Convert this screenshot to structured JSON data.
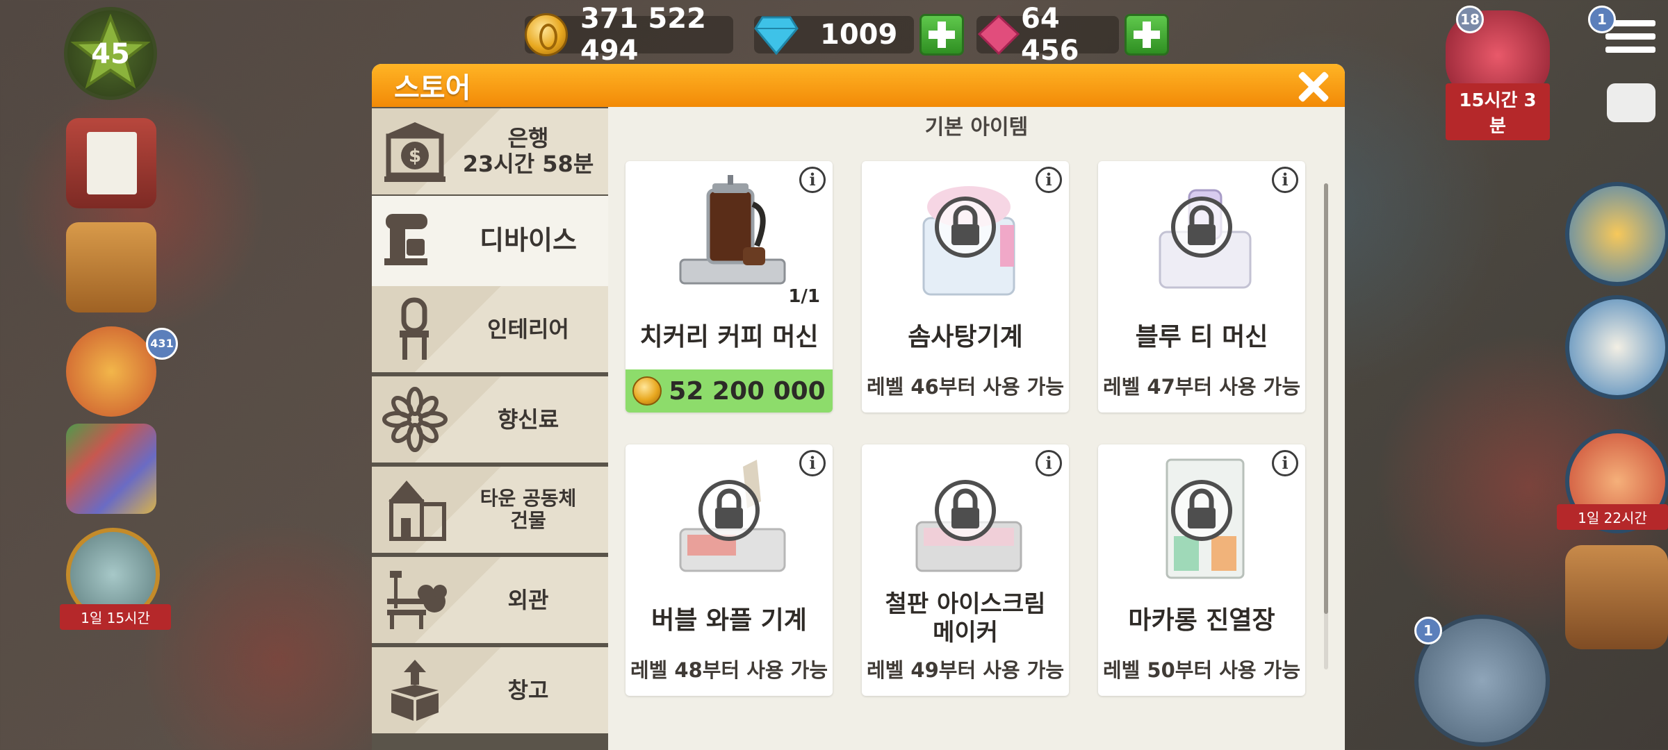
{
  "hud": {
    "coins": "371 522 494",
    "diamonds": "1009",
    "rubies": "64 456",
    "level": "45",
    "left_timer": "1일 15시간",
    "gift_badge": "431",
    "gift_box_badge": "18",
    "gift_box_timer": "15시간 3분",
    "menu_badge": "1",
    "balloon_timer": "1일 22시간",
    "cash_register_badge": "1"
  },
  "store": {
    "title": "스토어",
    "section_title": "기본 아이템",
    "tabs": [
      {
        "label": "은행\n23시간 58분",
        "icon": "bank-icon"
      },
      {
        "label": "디바이스",
        "icon": "mixer-icon"
      },
      {
        "label": "인테리어",
        "icon": "chair-icon"
      },
      {
        "label": "향신료",
        "icon": "star-anise-icon"
      },
      {
        "label": "타운 공동체\n건물",
        "icon": "town-building-icon"
      },
      {
        "label": "외관",
        "icon": "bench-icon"
      },
      {
        "label": "창고",
        "icon": "storage-box-icon"
      }
    ],
    "items": [
      {
        "name": "치커리 커피 머신",
        "price": "52 200 000",
        "count": "1/1",
        "info": "i"
      },
      {
        "name": "솜사탕기계",
        "requirement": "레벨 46부터 사용 가능",
        "info": "i"
      },
      {
        "name": "블루 티 머신",
        "requirement": "레벨 47부터 사용 가능",
        "info": "i"
      },
      {
        "name": "버블 와플 기계",
        "requirement": "레벨 48부터 사용 가능",
        "info": "i"
      },
      {
        "name": "철판 아이스크림\n메이커",
        "requirement": "레벨 49부터 사용 가능",
        "info": "i"
      },
      {
        "name": "마카롱 진열장",
        "requirement": "레벨 50부터 사용 가능",
        "info": "i"
      }
    ]
  },
  "colors": {
    "header_orange": "#f28a07",
    "price_green": "#8ddc6b",
    "plus_green": "#2f8f22"
  }
}
